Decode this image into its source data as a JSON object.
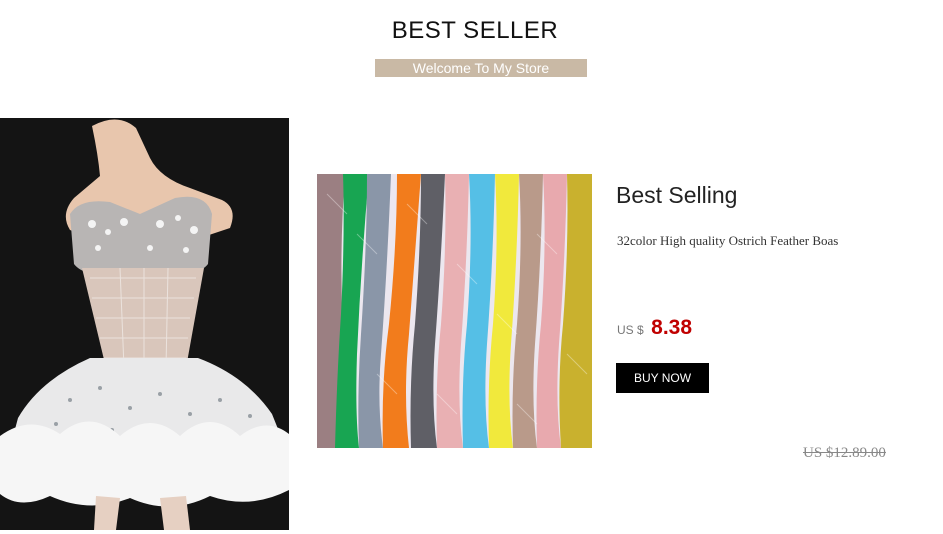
{
  "header": {
    "title": "BEST SELLER",
    "subtitle": "Welcome To My Store",
    "subtitle_bg": "#c9b9a5"
  },
  "product": {
    "heading": "Best Selling",
    "description": "32color High quality Ostrich Feather Boas",
    "currency": "US $",
    "price": "8.38",
    "price_color": "#c00000",
    "buy_label": "BUY NOW",
    "original_price": "US $12.89.00"
  },
  "images": {
    "left": "dress-photo",
    "middle": "feather-boas-photo",
    "boa_colors": [
      "#9b7f82",
      "#18a552",
      "#8a96a8",
      "#f27c1c",
      "#5f5f66",
      "#e9b0b3",
      "#55bfe6",
      "#f1e93c",
      "#b99a8a",
      "#e8a9ae",
      "#c9b12e"
    ]
  }
}
